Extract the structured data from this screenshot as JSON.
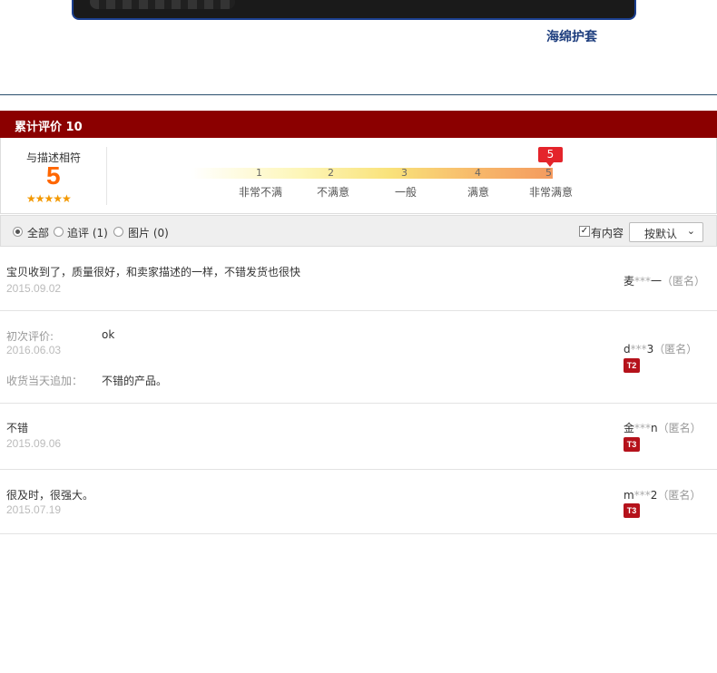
{
  "banner": {
    "caption": "海绵护套"
  },
  "header": {
    "title": "累计评价 10"
  },
  "summary": {
    "label": "与描述相符",
    "score": "5",
    "stars": "★★★★★",
    "pointer_value": "5",
    "scale_numbers": [
      "1",
      "2",
      "3",
      "4",
      "5"
    ],
    "scale_labels": [
      "非常不满",
      "不满意",
      "一般",
      "满意",
      "非常满意"
    ]
  },
  "filters": {
    "all": "全部",
    "followup": "追评 (1)",
    "pictures": "图片 (0)",
    "has_content": "有内容",
    "sort": "按默认"
  },
  "reviews": [
    {
      "content": "宝贝收到了，质量很好，和卖家描述的一样，不错发货也很快",
      "date": "2015.09.02",
      "user_prefix": "麦",
      "user_mask": "***",
      "user_suffix": "一",
      "anon": "（匿名）"
    },
    {
      "initial_label": "初次评价:",
      "content": "ok",
      "date": "2016.06.03",
      "followup_label": "收货当天追加：",
      "followup": "不错的产品。",
      "user_prefix": "d",
      "user_mask": "***",
      "user_suffix": "3",
      "anon": "（匿名）",
      "badge": "T2"
    },
    {
      "content": "不错",
      "date": "2015.09.06",
      "user_prefix": "金",
      "user_mask": "***",
      "user_suffix": "n",
      "anon": "（匿名）",
      "badge": "T3"
    },
    {
      "content": "很及时，很强大。",
      "date": "2015.07.19",
      "user_prefix": "m",
      "user_mask": "***",
      "user_suffix": "2",
      "anon": "（匿名）",
      "badge": "T3"
    }
  ],
  "colors": {
    "header_bg": "#8b0000",
    "score": "#ff6600",
    "pointer": "#e4242b",
    "badge": "#b5121b"
  }
}
